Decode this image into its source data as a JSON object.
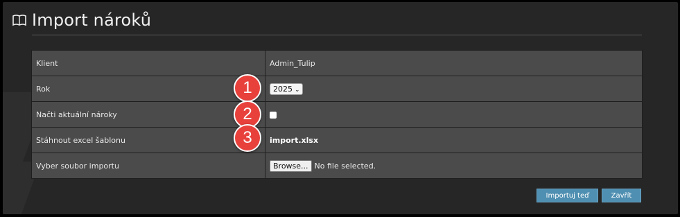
{
  "page": {
    "title": "Import nároků",
    "icon": "book-icon"
  },
  "rows": [
    {
      "label": "Klient",
      "value": "Admin_Tulip"
    },
    {
      "label": "Rok",
      "value": "2025"
    },
    {
      "label": "Načti aktuální nároky"
    },
    {
      "label": "Stáhnout excel šablonu",
      "link": "import.xlsx"
    },
    {
      "label": "Vyber soubor importu",
      "browse": "Browse...",
      "file_status": "No file selected."
    }
  ],
  "markers": [
    "1",
    "2",
    "3"
  ],
  "buttons": {
    "import": "Importuj teď",
    "close": "Zavřít"
  },
  "colors": {
    "marker": "#e8413c",
    "button": "#4f8fb1"
  }
}
